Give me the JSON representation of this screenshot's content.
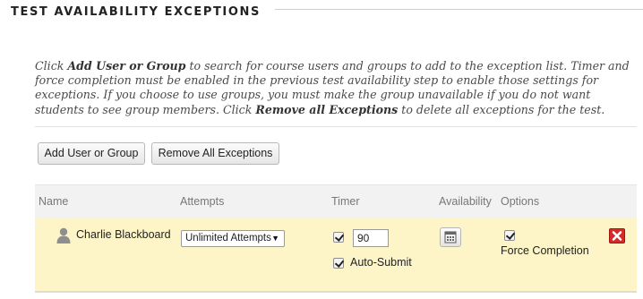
{
  "section": {
    "title": "TEST AVAILABILITY EXCEPTIONS"
  },
  "instructions": {
    "p1": "Click ",
    "add_link": "Add User or Group",
    "p2": " to search for course users and groups to add to the exception list. Timer and force completion must be enabled in the previous test availability step to enable those settings for exceptions. If you choose to use groups, you must make the group unavailable if you do not want students to see group members. Click ",
    "remove_link": "Remove all Exceptions",
    "p3": " to delete all exceptions for the test."
  },
  "buttons": {
    "add": "Add User or Group",
    "remove_all": "Remove All Exceptions"
  },
  "table": {
    "headers": {
      "name": "Name",
      "attempts": "Attempts",
      "timer": "Timer",
      "availability": "Availability",
      "options": "Options"
    },
    "rows": [
      {
        "name": "Charlie Blackboard",
        "attempts": "Unlimited Attempts",
        "timer_enabled": true,
        "timer_value": "90",
        "auto_submit_checked": true,
        "auto_submit_label": "Auto-Submit",
        "force_completion_checked": true,
        "force_completion_label": "Force Completion"
      }
    ]
  },
  "icons": {
    "avatar": "user-silhouette-icon",
    "calendar": "calendar-icon",
    "delete": "delete-x-icon",
    "dropdown": "chevron-down-icon"
  },
  "colors": {
    "row_highlight": "#fdf5c8",
    "header_bg": "#f2f2f2",
    "delete_red": "#d42a2a"
  }
}
